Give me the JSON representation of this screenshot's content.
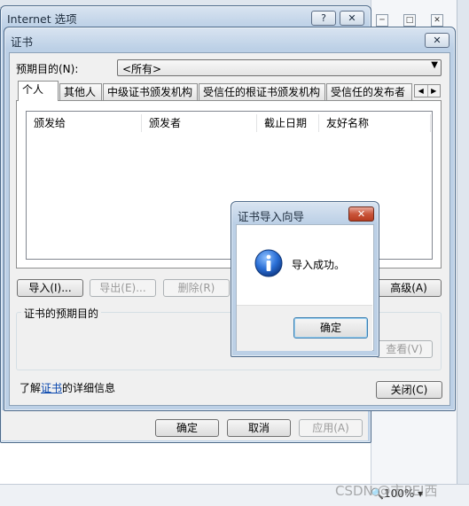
{
  "internet_options": {
    "title": "Internet 选项",
    "help_label": "?",
    "close_label": "✕",
    "ok_label": "确定",
    "cancel_label": "取消",
    "apply_label": "应用(A)"
  },
  "certificates": {
    "title": "证书",
    "close_label": "✕",
    "purpose_label": "预期目的(N):",
    "purpose_value": "<所有>",
    "tabs": [
      {
        "label": "个人"
      },
      {
        "label": "其他人"
      },
      {
        "label": "中级证书颁发机构"
      },
      {
        "label": "受信任的根证书颁发机构"
      },
      {
        "label": "受信任的发布者"
      }
    ],
    "columns": [
      {
        "label": "颁发给"
      },
      {
        "label": "颁发者"
      },
      {
        "label": "截止日期"
      },
      {
        "label": "友好名称"
      }
    ],
    "import_label": "导入(I)...",
    "export_label": "导出(E)...",
    "remove_label": "删除(R)",
    "advanced_label": "高级(A)",
    "purposes_group_label": "证书的预期目的",
    "view_label": "查看(V)",
    "learn_prefix": "了解",
    "learn_link": "证书",
    "learn_suffix": "的详细信息",
    "close_button": "关闭(C)"
  },
  "wizard": {
    "title": "证书导入向导",
    "close_label": "✕",
    "message": "导入成功。",
    "ok_label": "确定"
  },
  "background": {
    "zoom": "100%",
    "watermark": "CSDN @市PEI西"
  },
  "colors": {
    "accent": "#3c7fb1",
    "info_icon": "#1e62c2",
    "link": "#0645ad"
  }
}
